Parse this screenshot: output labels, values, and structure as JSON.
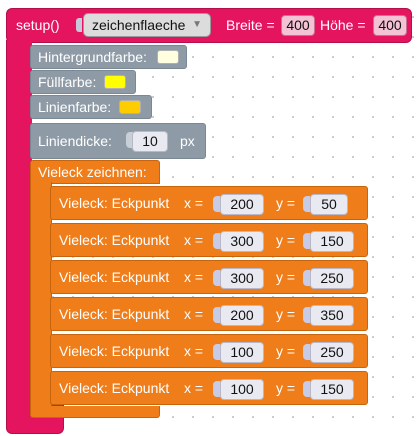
{
  "setup": {
    "label": "setup()",
    "canvas_dropdown": "zeichenflaeche",
    "width_label": "Breite =",
    "width_value": "400",
    "height_label": "Höhe =",
    "height_value": "400"
  },
  "background": {
    "label": "Hintergrundfarbe:",
    "color": "#ffffe0"
  },
  "fill": {
    "label": "Füllfarbe:",
    "color": "#ffff00"
  },
  "stroke": {
    "label": "Linienfarbe:",
    "color": "#ffcc00"
  },
  "line_width": {
    "label": "Liniendicke:",
    "value": "10",
    "unit": "px"
  },
  "polygon": {
    "label": "Vieleck zeichnen:",
    "vertex_label": "Vieleck: Eckpunkt",
    "x_label": "x =",
    "y_label": "y =",
    "vertices": [
      {
        "x": "200",
        "y": "50"
      },
      {
        "x": "300",
        "y": "150"
      },
      {
        "x": "300",
        "y": "250"
      },
      {
        "x": "200",
        "y": "350"
      },
      {
        "x": "100",
        "y": "250"
      },
      {
        "x": "100",
        "y": "150"
      }
    ]
  }
}
